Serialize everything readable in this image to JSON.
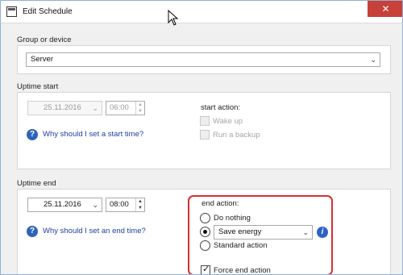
{
  "window": {
    "title": "Edit Schedule",
    "close_glyph": "✕"
  },
  "group": {
    "label": "Group or device",
    "selected": "Server"
  },
  "uptime_start": {
    "label": "Uptime start",
    "date": "25.11.2016",
    "time": "06:00",
    "help_link": "Why should I set a start time?",
    "action_label": "start action:",
    "options": [
      "Wake up",
      "Run a backup"
    ]
  },
  "uptime_end": {
    "label": "Uptime end",
    "date": "25.11.2016",
    "time": "08:00",
    "help_link": "Why should I set an end time?",
    "action_label": "end action:",
    "radio_options": [
      "Do nothing",
      "Save energy",
      "Standard action"
    ],
    "save_energy_selected": "Save energy",
    "force_label": "Force end action"
  },
  "colors": {
    "highlight": "#d43030",
    "link": "#1f3ea0",
    "close": "#c7403a"
  }
}
